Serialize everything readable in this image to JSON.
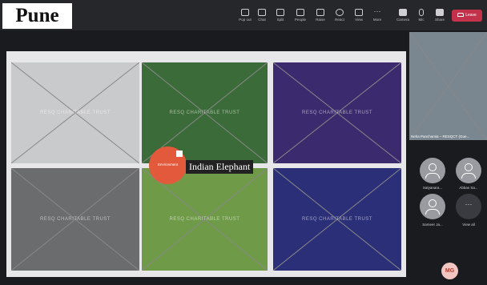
{
  "city_label": "Pune",
  "toolbar": {
    "items": [
      {
        "label": "Pop out",
        "icon": "pop-out-icon"
      },
      {
        "label": "Chat",
        "icon": "chat-icon"
      },
      {
        "label": "Split",
        "icon": "split-icon"
      },
      {
        "label": "People",
        "icon": "people-icon",
        "count": "106"
      },
      {
        "label": "Raise",
        "icon": "raise-hand-icon"
      },
      {
        "label": "React",
        "icon": "react-icon"
      },
      {
        "label": "View",
        "icon": "view-icon"
      },
      {
        "label": "More",
        "icon": "more-icon"
      },
      {
        "label": "Camera",
        "icon": "camera-icon"
      },
      {
        "label": "Mic",
        "icon": "mic-icon"
      },
      {
        "label": "Share",
        "icon": "share-icon"
      }
    ],
    "leave_label": "Leave"
  },
  "slide": {
    "watermark": "RESQ CHARITABLE TRUST",
    "badge_text": "Environment",
    "caption": "Indian Elephant"
  },
  "video": {
    "name": "Neha Panchamia – RESQCT (Gue..."
  },
  "participants": [
    {
      "name": "Satyanara..."
    },
    {
      "name": "Abbas Sa..."
    },
    {
      "name": "Sameer Ja..."
    }
  ],
  "view_all_label": "View all",
  "self_initials": "MG",
  "colors": {
    "leave": "#c4314b",
    "badge": "#e2593b",
    "avatar": "#f1c6c0"
  }
}
